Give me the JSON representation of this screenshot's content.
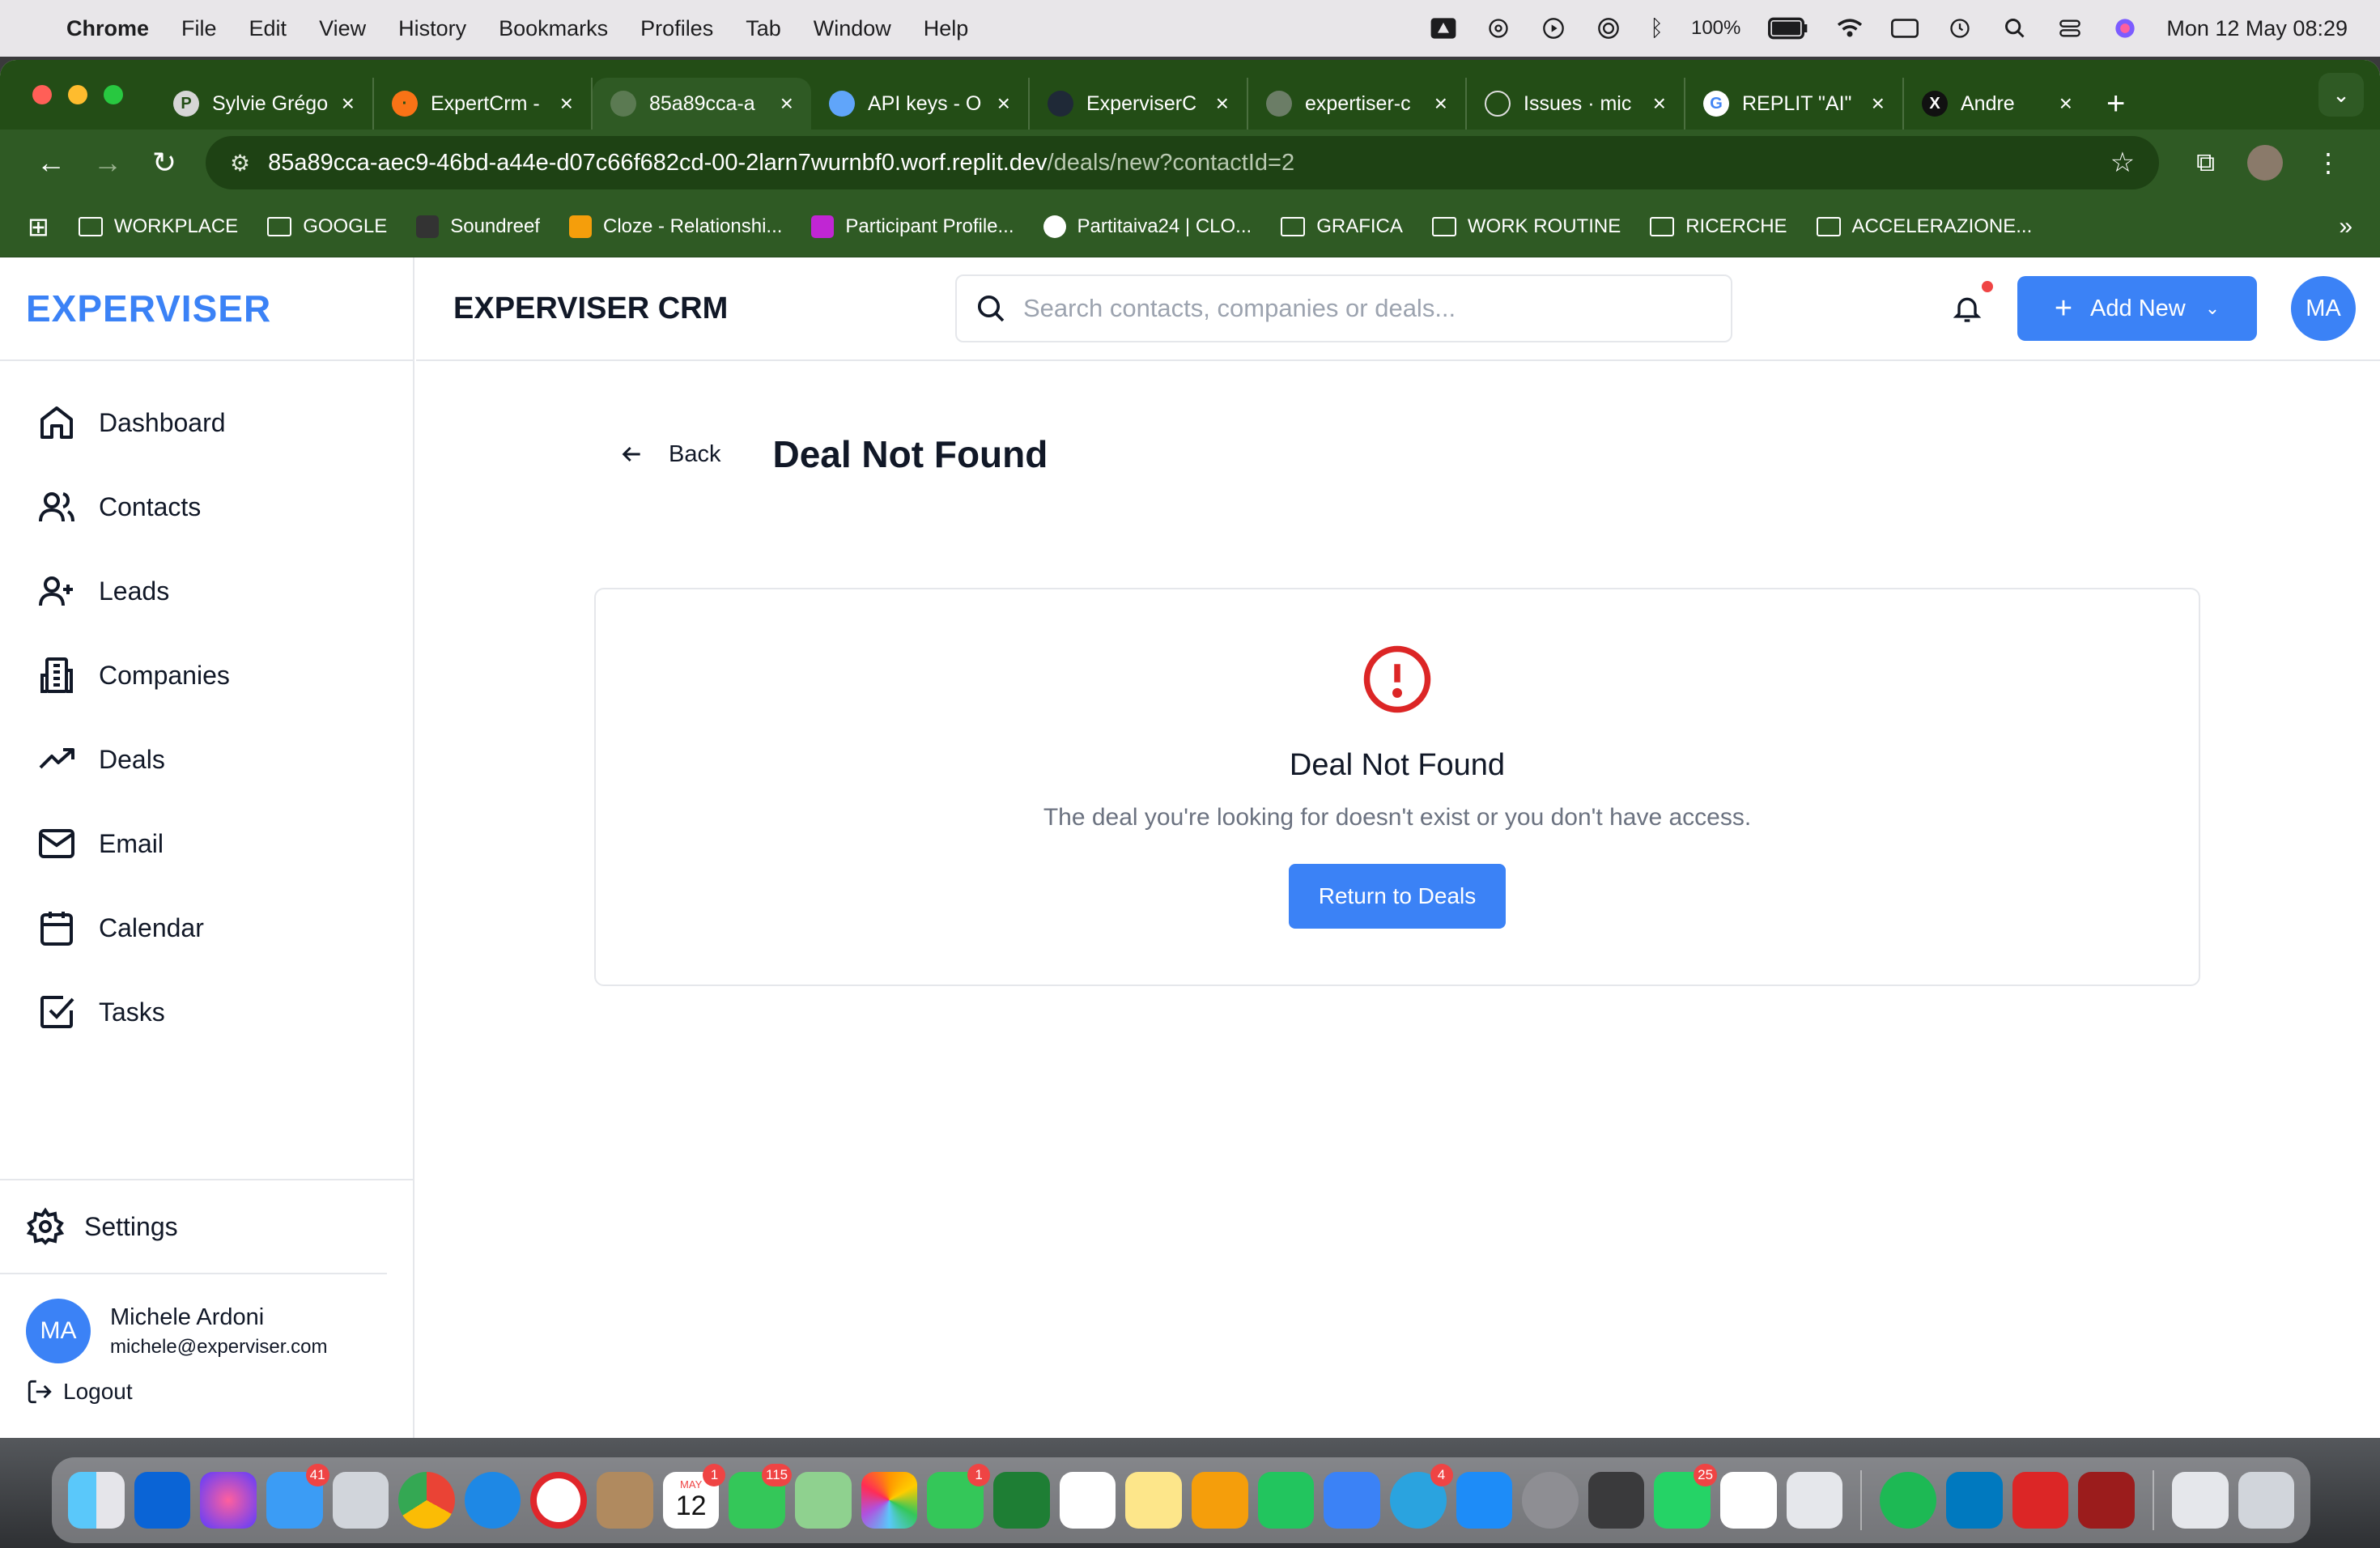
{
  "menubar": {
    "app": "Chrome",
    "items": [
      "File",
      "Edit",
      "View",
      "History",
      "Bookmarks",
      "Profiles",
      "Tab",
      "Window",
      "Help"
    ],
    "battery": "100%",
    "datetime": "Mon 12 May  08:29"
  },
  "tabs": [
    {
      "title": "Sylvie Grégo",
      "icon": "P"
    },
    {
      "title": "ExpertCrm -",
      "icon": "·"
    },
    {
      "title": "85a89cca-a",
      "icon": "",
      "active": true
    },
    {
      "title": "API keys - O",
      "icon": ""
    },
    {
      "title": "ExperviserC",
      "icon": ""
    },
    {
      "title": "expertiser-c",
      "icon": ""
    },
    {
      "title": "Issues · mic",
      "icon": ""
    },
    {
      "title": "REPLIT \"AI\"",
      "icon": "G"
    },
    {
      "title": "Andre",
      "icon": "X"
    }
  ],
  "address": {
    "host": "85a89cca-aec9-46bd-a44e-d07c66f682cd-00-2larn7wurnbf0.worf.replit.dev",
    "path": "/deals/new?contactId=2"
  },
  "bookmarks": [
    {
      "label": "WORKPLACE",
      "kind": "folder"
    },
    {
      "label": "GOOGLE",
      "kind": "folder"
    },
    {
      "label": "Soundreef",
      "kind": "site",
      "color": "#333333"
    },
    {
      "label": "Cloze - Relationshi...",
      "kind": "site",
      "color": "#f59e0b"
    },
    {
      "label": "Participant Profile...",
      "kind": "site",
      "color": "#c026d3"
    },
    {
      "label": "Partitaiva24 | CLO...",
      "kind": "site",
      "color": "#ffffff"
    },
    {
      "label": "GRAFICA",
      "kind": "folder"
    },
    {
      "label": "WORK ROUTINE",
      "kind": "folder"
    },
    {
      "label": "RICERCHE",
      "kind": "folder"
    },
    {
      "label": "ACCELERAZIONE...",
      "kind": "folder"
    }
  ],
  "brand": "EXPERVISER",
  "nav": [
    {
      "label": "Dashboard",
      "icon": "home-icon"
    },
    {
      "label": "Contacts",
      "icon": "users-icon"
    },
    {
      "label": "Leads",
      "icon": "user-plus-icon"
    },
    {
      "label": "Companies",
      "icon": "building-icon"
    },
    {
      "label": "Deals",
      "icon": "trending-up-icon"
    },
    {
      "label": "Email",
      "icon": "mail-icon"
    },
    {
      "label": "Calendar",
      "icon": "calendar-icon"
    },
    {
      "label": "Tasks",
      "icon": "check-square-icon"
    }
  ],
  "settings_label": "Settings",
  "user": {
    "initials": "MA",
    "name": "Michele Ardoni",
    "email": "michele@experviser.com"
  },
  "logout_label": "Logout",
  "header": {
    "title": "EXPERVISER CRM",
    "search_placeholder": "Search contacts, companies or deals...",
    "add_new": "Add New",
    "avatar": "MA"
  },
  "page": {
    "back": "Back",
    "title": "Deal Not Found",
    "card_title": "Deal Not Found",
    "message": "The deal you're looking for doesn't exist or you don't have access.",
    "button": "Return to Deals"
  },
  "colors": {
    "accent": "#3b82f6",
    "error": "#dc2626",
    "chrome": "#2f5a24"
  },
  "dock": {
    "badges": {
      "mail": "41",
      "calendar": "1",
      "messages": "115",
      "facetime": "1",
      "telegram": "4",
      "whatsapp": "25"
    },
    "calendar_month": "MAY",
    "calendar_day": "12"
  }
}
